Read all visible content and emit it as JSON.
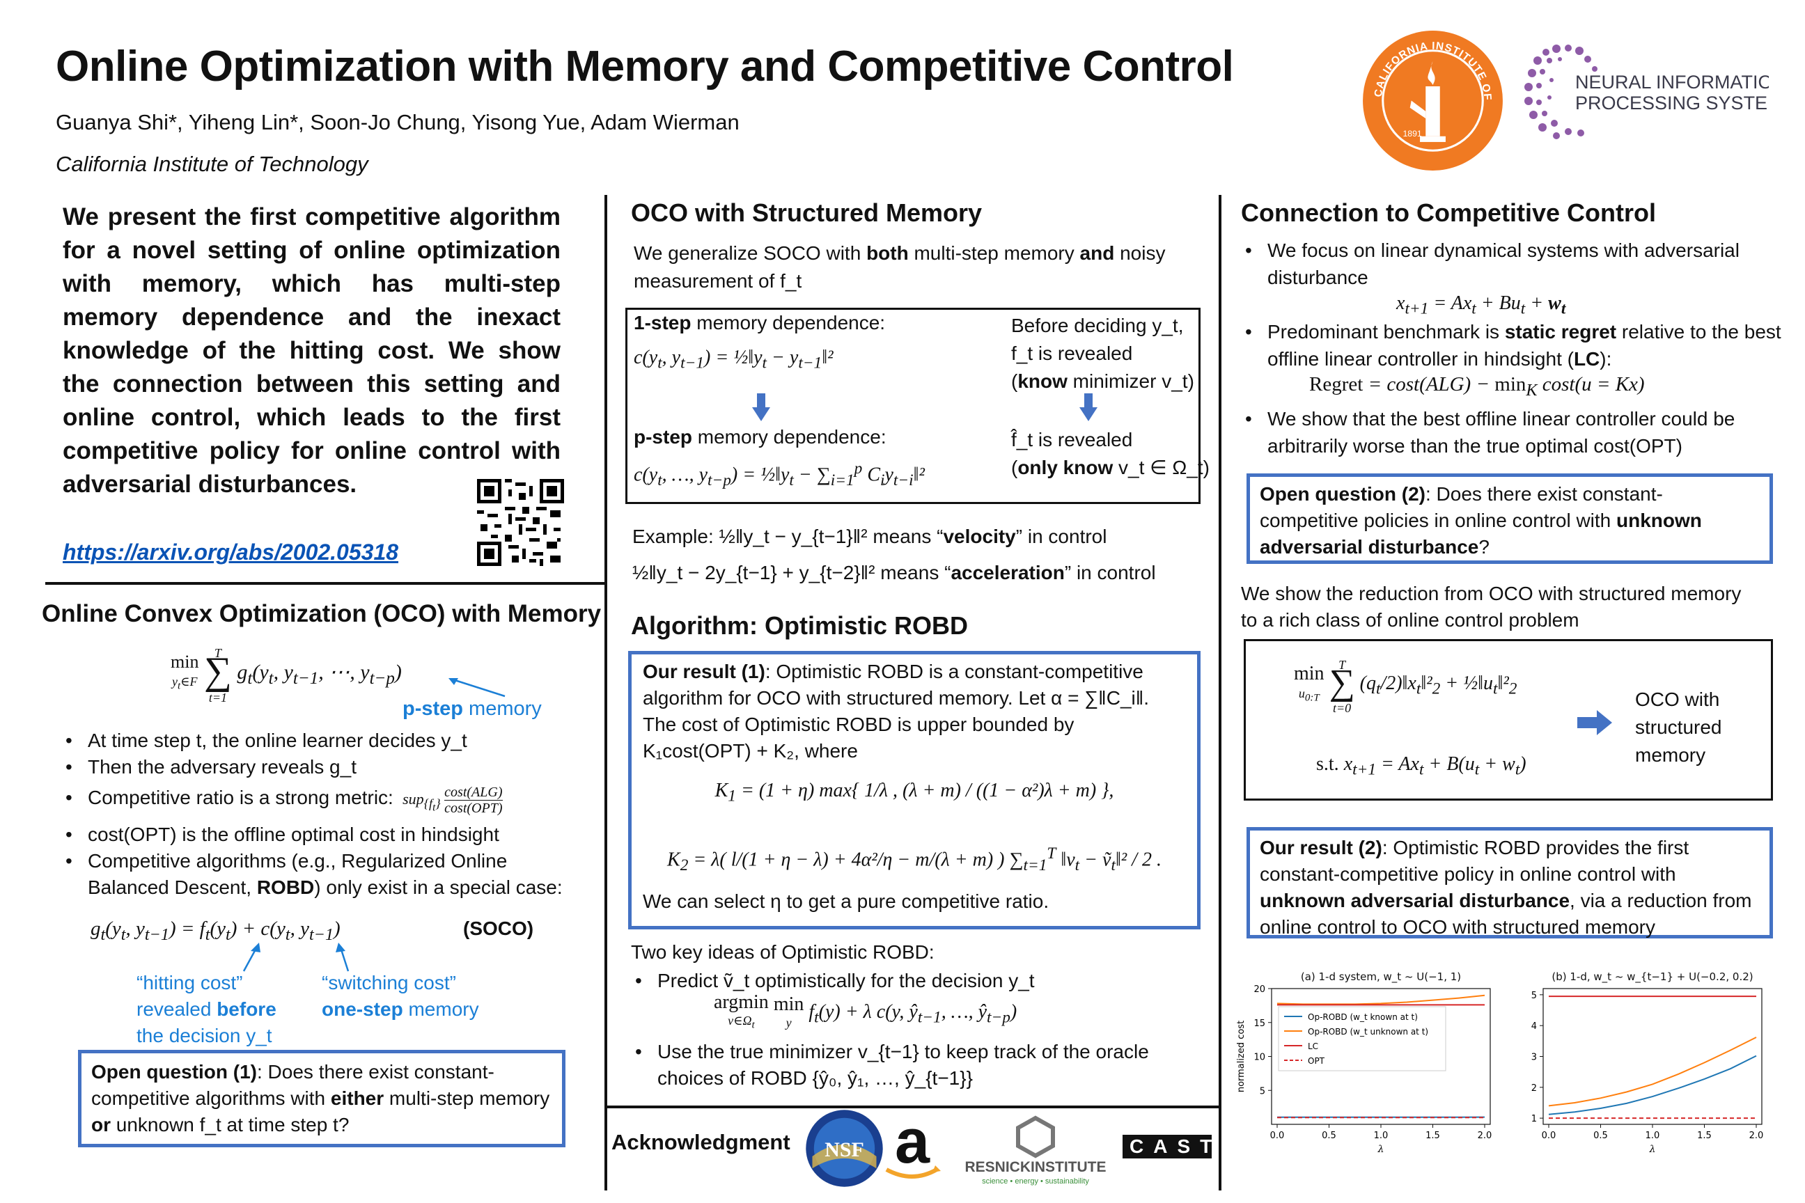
{
  "header": {
    "title": "Online Optimization with Memory and Competitive Control",
    "authors": "Guanya Shi*, Yiheng Lin*, Soon-Jo Chung, Yisong Yue, Adam Wierman",
    "affiliation": "California Institute of Technology",
    "caltech_seal_text": "CALIFORNIA INSTITUTE OF TECHNOLOGY",
    "caltech_year": "1891",
    "neurips_line1": "NEURAL INFORMATION",
    "neurips_line2": "PROCESSING SYSTEMS"
  },
  "col1": {
    "abstract": "We present the first competitive algorithm for a novel setting of online optimization with memory, which has multi-step memory dependence and the inexact knowledge of the hitting cost. We show the connection between this setting and online control, which leads to the first competitive policy for online control with adversarial disturbances.",
    "arxiv_link": "https://arxiv.org/abs/2002.05318",
    "oco_heading": "Online Convex Optimization (OCO) with Memory",
    "pstep_note_bold": "p-step",
    "pstep_note_rest": " memory",
    "bullets": {
      "b1": "At time step t, the online learner decides y_t",
      "b2": "Then the adversary reveals g_t",
      "b3": "Competitive ratio is a strong metric:",
      "b3_cont": "cost(OPT) is the offline optimal cost in hindsight",
      "b4_a": "Competitive algorithms (e.g., Regularized Online Balanced Descent, ",
      "b4_bold": "ROBD",
      "b4_b": ") only exist in a special case:"
    },
    "soco_label": "(SOCO)",
    "hitting_note_1": "“hitting cost”",
    "hitting_note_2a": "revealed ",
    "hitting_note_2b": "before",
    "hitting_note_3": "the decision y_t",
    "switching_note_1": "“switching cost”",
    "switching_note_2a": "one-step",
    "switching_note_2b": " memory",
    "open_q1_bold": "Open question (1)",
    "open_q1_a": ": Does there exist constant-competitive algorithms with ",
    "open_q1_either": "either",
    "open_q1_b": " multi-step memory ",
    "open_q1_or": "or",
    "open_q1_c": " unknown f_t at time step t?"
  },
  "col2": {
    "heading": "OCO with Structured Memory",
    "intro_a": "We generalize SOCO with ",
    "intro_both": "both",
    "intro_b": " multi-step memory ",
    "intro_and": "and",
    "intro_c": " noisy measurement of f_t",
    "one_step_bold": "1-step",
    "one_step_rest": " memory dependence:",
    "before_deciding": "Before deciding y_t,",
    "ft_revealed": "f_t is revealed",
    "know_bold": "know",
    "know_rest": " minimizer v_t)",
    "p_step_bold": "p-step",
    "p_step_rest": " memory dependence:",
    "fhat_revealed": "f̂_t is revealed",
    "only_know_bold": "only know",
    "only_know_rest": " v_t ∈ Ω_t)",
    "example_a": "Example: ½‖y_t − y_{t−1}‖² means “",
    "example_velocity": "velocity",
    "example_b": "” in control",
    "example2_a": "½‖y_t − 2y_{t−1} + y_{t−2}‖² means “",
    "example2_accel": "acceleration",
    "example2_b": "” in control",
    "alg_heading": "Algorithm: Optimistic ROBD",
    "result1_bold": "Our result (1)",
    "result1_a": ": Optimistic ROBD is a constant-competitive algorithm for OCO with structured memory. Let α = ∑‖C_i‖. The cost of Optimistic ROBD is upper bounded by K₁cost(OPT) + K₂, where",
    "result1_end": "We can select η to get a pure competitive ratio.",
    "two_key": "Two key ideas of Optimistic ROBD:",
    "key1": "Predict ṽ_t optimistically for the decision y_t",
    "key2": "Use the true minimizer v_{t−1} to keep track of the oracle choices of ROBD {ŷ₀, ŷ₁, …, ŷ_{t−1}}",
    "ack": "Acknowledgment",
    "nsf": "NSF",
    "resnick_main": "RESNICKINSTITUTE",
    "resnick_sub": "science • energy • sustainability",
    "cast": "CAST"
  },
  "col3": {
    "heading": "Connection to Competitive Control",
    "b1": "We focus on linear dynamical systems with adversarial disturbance",
    "b2_a": "Predominant benchmark is ",
    "b2_bold": "static regret",
    "b2_b": " relative to the best offline linear controller in hindsight (",
    "b2_lc": "LC",
    "b2_c": "):",
    "b3": "We show that the best offline linear controller could be arbitrarily worse than the true optimal cost(OPT)",
    "open_q2_bold": "Open question (2)",
    "open_q2_a": ": Does there exist constant-competitive policies in online control with ",
    "open_q2_b": "unknown adversarial disturbance",
    "open_q2_c": "?",
    "reduction": "We show the reduction from OCO with structured memory to a rich class of online control problem",
    "oco_with": "OCO with structured memory",
    "result2_bold": "Our result (2)",
    "result2_a": ": Optimistic ROBD provides the first constant-competitive policy in online control with ",
    "result2_b": "unknown adversarial disturbance",
    "result2_c": ", via a reduction from online control to OCO with structured memory"
  },
  "chart_data": [
    {
      "type": "line",
      "title": "(a) 1-d system, w_t ~ U(−1, 1)",
      "xlabel": "λ",
      "ylabel": "normalized cost",
      "x": [
        0.0,
        0.25,
        0.5,
        0.75,
        1.0,
        1.25,
        1.5,
        1.75,
        2.0
      ],
      "ylim": [
        0,
        20
      ],
      "xticks": [
        "0.0",
        "0.5",
        "1.0",
        "1.5",
        "2.0"
      ],
      "yticks": [
        "5",
        "10",
        "15",
        "20"
      ],
      "legend_position": "center-left",
      "series": [
        {
          "name": "Op-ROBD (w_t known at t)",
          "color": "#1f77b4",
          "style": "solid",
          "values": [
            1.05,
            1.05,
            1.05,
            1.05,
            1.06,
            1.06,
            1.06,
            1.06,
            1.07
          ]
        },
        {
          "name": "Op-ROBD (w_t unknown at t)",
          "color": "#ff7f0e",
          "style": "solid",
          "values": [
            17.8,
            17.7,
            17.7,
            17.7,
            17.8,
            18.0,
            18.3,
            18.6,
            19.0
          ]
        },
        {
          "name": "LC",
          "color": "#d62728",
          "style": "solid",
          "values": [
            17.6,
            17.6,
            17.6,
            17.6,
            17.6,
            17.6,
            17.6,
            17.6,
            17.6
          ]
        },
        {
          "name": "OPT",
          "color": "#d62728",
          "style": "dashed",
          "values": [
            1.0,
            1.0,
            1.0,
            1.0,
            1.0,
            1.0,
            1.0,
            1.0,
            1.0
          ]
        }
      ]
    },
    {
      "type": "line",
      "title": "(b) 1-d, w_t ~ w_{t−1} + U(−0.2, 0.2)",
      "xlabel": "λ",
      "ylabel": "",
      "x": [
        0.0,
        0.25,
        0.5,
        0.75,
        1.0,
        1.25,
        1.5,
        1.75,
        2.0
      ],
      "ylim": [
        0.8,
        5.2
      ],
      "xticks": [
        "0.0",
        "0.5",
        "1.0",
        "1.5",
        "2.0"
      ],
      "yticks": [
        "1",
        "2",
        "3",
        "4",
        "5"
      ],
      "series": [
        {
          "color": "#1f77b4",
          "style": "solid",
          "values": [
            1.12,
            1.2,
            1.32,
            1.48,
            1.7,
            1.97,
            2.27,
            2.6,
            3.02
          ]
        },
        {
          "color": "#ff7f0e",
          "style": "solid",
          "values": [
            1.4,
            1.5,
            1.65,
            1.85,
            2.1,
            2.43,
            2.8,
            3.2,
            3.62
          ]
        },
        {
          "color": "#d62728",
          "style": "solid",
          "values": [
            4.95,
            4.95,
            4.95,
            4.95,
            4.95,
            4.95,
            4.95,
            4.95,
            4.95
          ]
        },
        {
          "color": "#d62728",
          "style": "dashed",
          "values": [
            1.0,
            1.0,
            1.0,
            1.0,
            1.0,
            1.0,
            1.0,
            1.0,
            1.0
          ]
        }
      ]
    }
  ]
}
